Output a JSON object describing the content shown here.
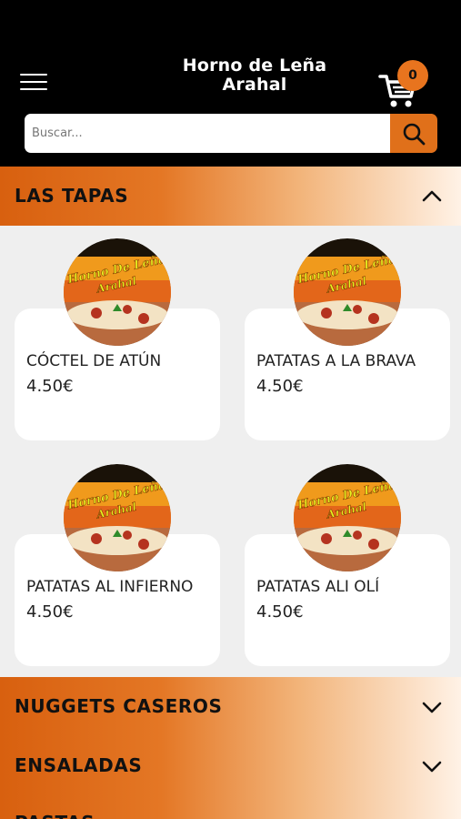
{
  "header": {
    "title_line1": "Horno de Leña",
    "title_line2": "Arahal",
    "cart_count": "0"
  },
  "search": {
    "placeholder": "Buscar..."
  },
  "categories": [
    {
      "label": "LAS TAPAS",
      "state": "expanded"
    },
    {
      "label": "NUGGETS CASEROS",
      "state": "collapsed"
    },
    {
      "label": "ENSALADAS",
      "state": "collapsed"
    },
    {
      "label": "PASTAS",
      "state": "collapsed"
    }
  ],
  "products": [
    {
      "name": "CÓCTEL DE ATÚN",
      "price": "4.50€"
    },
    {
      "name": "PATATAS A LA BRAVA",
      "price": "4.50€"
    },
    {
      "name": "PATATAS AL INFIERNO",
      "price": "4.50€"
    },
    {
      "name": "PATATAS ALI OLÍ",
      "price": "4.50€"
    }
  ],
  "logo_text": {
    "line1": "Horno De Leña",
    "line2": "Arahal"
  },
  "colors": {
    "accent": "#e0701a",
    "header_bg": "#000000",
    "page_bg": "#efefef"
  }
}
